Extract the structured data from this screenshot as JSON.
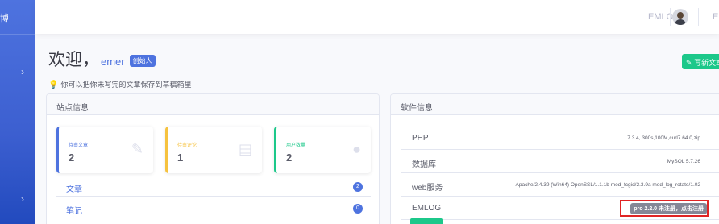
{
  "sidebar": {
    "brand": "博"
  },
  "topbar": {
    "site_label": "EMLOG",
    "right_text": "El"
  },
  "welcome": {
    "greeting": "欢迎，",
    "name": "emer",
    "role": "创始人"
  },
  "write_button": "写新文章",
  "tip": "你可以把你未写完的文章保存到草稿箱里",
  "site_info": {
    "title": "站点信息",
    "stats": [
      {
        "label": "待审文章",
        "value": "2"
      },
      {
        "label": "待审评论",
        "value": "1"
      },
      {
        "label": "用户数量",
        "value": "2"
      }
    ],
    "list": [
      {
        "label": "文章",
        "count": "2"
      },
      {
        "label": "笔记",
        "count": "0"
      }
    ]
  },
  "software_info": {
    "title": "软件信息",
    "rows": [
      {
        "key": "PHP",
        "value": "7.3.4, 300s,100M,curl7.64.0,zip"
      },
      {
        "key": "数据库",
        "value": "MySQL 5.7.26"
      },
      {
        "key": "web服务",
        "value": "Apache/2.4.39 (Win64) OpenSSL/1.1.1b mod_fcgid/2.3.9a mod_log_rotate/1.02"
      },
      {
        "key": "EMLOG",
        "value": "pro 2.2.0 未注册，点击注册"
      }
    ]
  },
  "colors": {
    "primary": "#4e73df",
    "success": "#1cc88a",
    "warning": "#f6c23e",
    "highlight": "#e02424"
  }
}
